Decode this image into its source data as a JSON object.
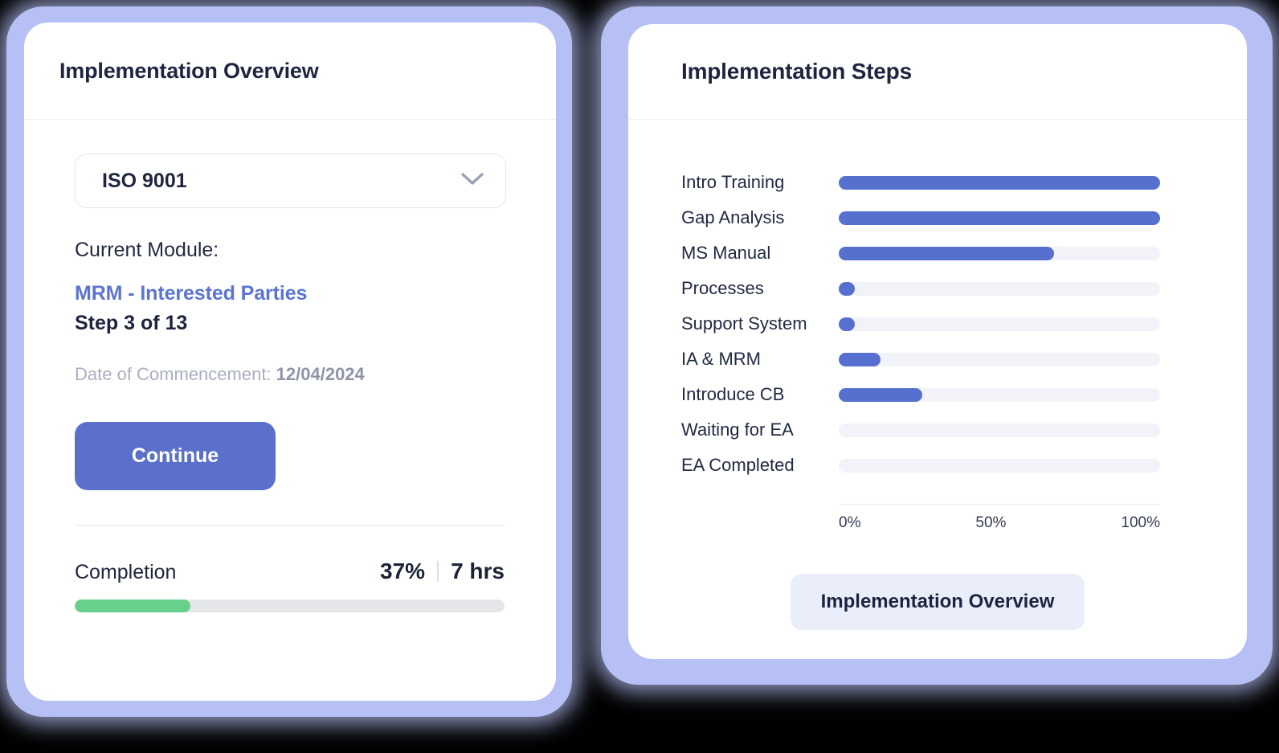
{
  "theme": {
    "accent_blue": "#5570ce",
    "glow_lavender": "#b6c0f4",
    "progress_green": "#68d08a",
    "track_gray": "#e5e6e9",
    "chart_track": "#f2f3f8",
    "soft_button_bg": "#eaeefb",
    "text_dark": "#1f2541",
    "text_muted": "#a9aec2",
    "link_blue": "#5b74d4"
  },
  "overview_card": {
    "title": "Implementation Overview",
    "standard_select": {
      "value": "ISO 9001",
      "icon": "chevron-down-icon"
    },
    "current_module_label": "Current Module:",
    "module_name": "MRM - Interested Parties",
    "step_text": "Step 3 of 13",
    "commencement_label": "Date of Commencement:",
    "commencement_date": "12/04/2024",
    "continue_label": "Continue",
    "completion_label": "Completion",
    "completion_percent_text": "37%",
    "completion_hours_text": "7 hrs",
    "completion_percent_value": 27
  },
  "steps_card": {
    "title": "Implementation Steps",
    "overview_button_label": "Implementation Overview"
  },
  "chart_data": {
    "type": "bar",
    "orientation": "horizontal",
    "title": "Implementation Steps",
    "xlabel": "",
    "ylabel": "",
    "xlim": [
      0,
      100
    ],
    "xticks": [
      0,
      50,
      100
    ],
    "xtick_labels": [
      "0%",
      "50%",
      "100%"
    ],
    "grid": false,
    "legend": false,
    "categories": [
      "Intro Training",
      "Gap Analysis",
      "MS Manual",
      "Processes",
      "Support System",
      "IA & MRM",
      "Introduce CB",
      "Waiting for EA",
      "EA Completed"
    ],
    "values": [
      100,
      100,
      67,
      5,
      5,
      13,
      26,
      0,
      0
    ],
    "bar_color": "#5570ce",
    "track_color": "#f2f3f8"
  }
}
